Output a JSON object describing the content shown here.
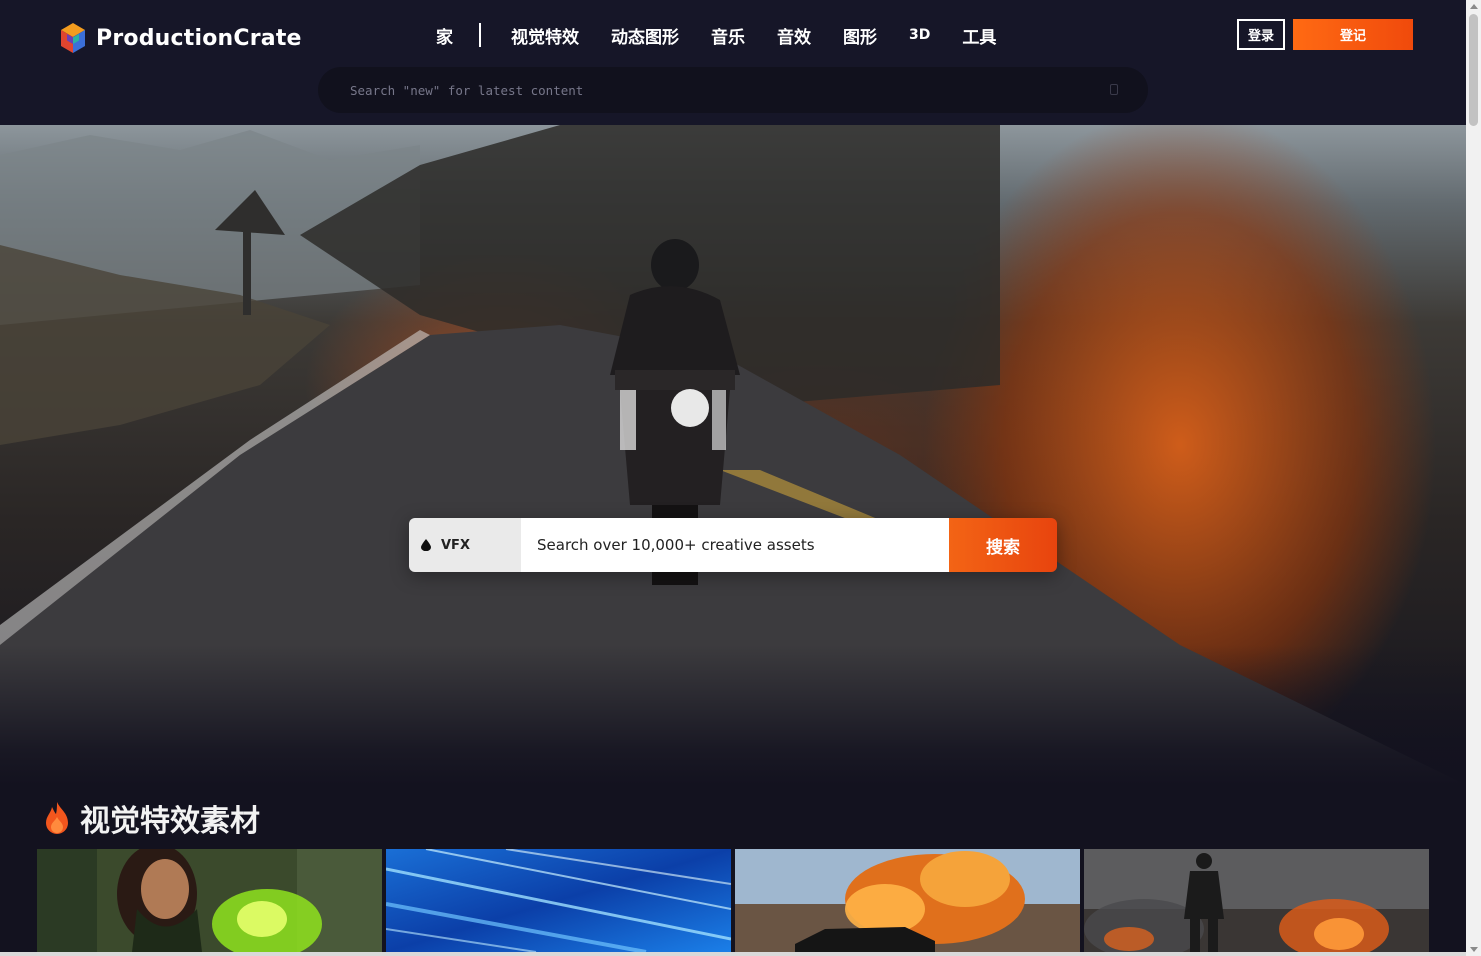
{
  "brand": {
    "name": "ProductionCrate",
    "logo_icon": "cube-logo-icon"
  },
  "nav": {
    "items": [
      {
        "label": "家",
        "small": false
      },
      {
        "label": "视觉特效",
        "small": false
      },
      {
        "label": "动态图形",
        "small": false
      },
      {
        "label": "音乐",
        "small": false
      },
      {
        "label": "音效",
        "small": false
      },
      {
        "label": "图形",
        "small": false
      },
      {
        "label": "3D",
        "small": true
      },
      {
        "label": "工具",
        "small": false
      }
    ]
  },
  "auth": {
    "login_label": "登录",
    "register_label": "登记"
  },
  "top_search": {
    "placeholder": "Search \"new\" for latest content"
  },
  "hero_search": {
    "category": "VFX",
    "category_icon": "droplet-icon",
    "placeholder": "Search over 10,000+ creative assets",
    "button_label": "搜索"
  },
  "section": {
    "title": "视觉特效素材",
    "icon": "fire-icon"
  },
  "cards": [
    {
      "name": "card-green-magic"
    },
    {
      "name": "card-blue-speed-lines"
    },
    {
      "name": "card-car-explosion"
    },
    {
      "name": "card-man-fire"
    }
  ],
  "colors": {
    "accent": "#f05a12",
    "header_bg": "#161628",
    "page_bg": "#13121f"
  }
}
